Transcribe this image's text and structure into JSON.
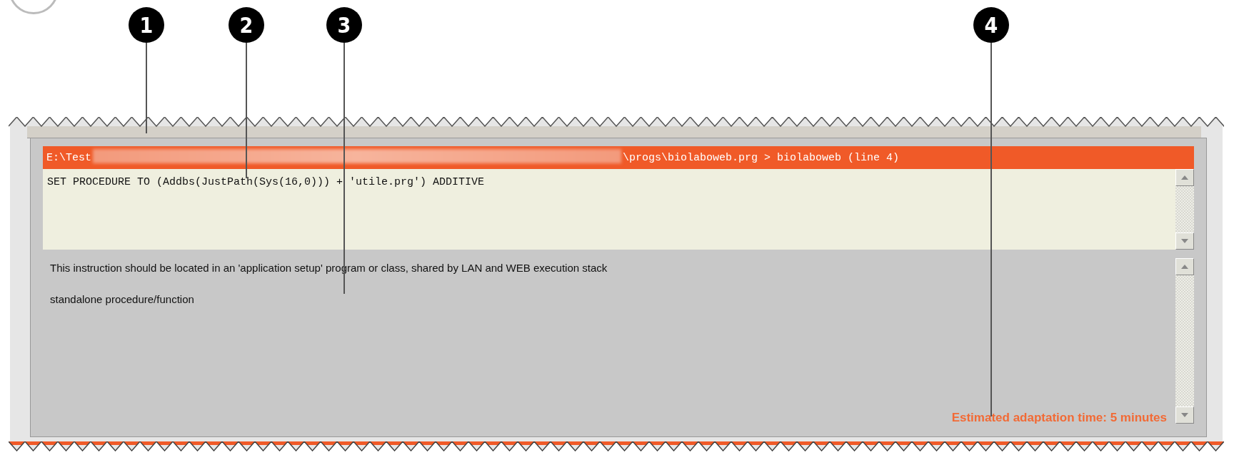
{
  "callouts": [
    {
      "number": "1"
    },
    {
      "number": "2"
    },
    {
      "number": "3"
    },
    {
      "number": "4"
    }
  ],
  "location": {
    "prefix": "E:\\Test",
    "redacted": true,
    "suffix": "\\progs\\biolaboweb.prg > biolaboweb (line 4)"
  },
  "code": "SET PROCEDURE TO (Addbs(JustPath(Sys(16,0))) + 'utile.prg') ADDITIVE",
  "messages": [
    "This instruction should be located in an 'application setup' program or class, shared by LAN and WEB execution stack",
    "standalone procedure/function"
  ],
  "estimate": "Estimated adaptation time: 5 minutes"
}
